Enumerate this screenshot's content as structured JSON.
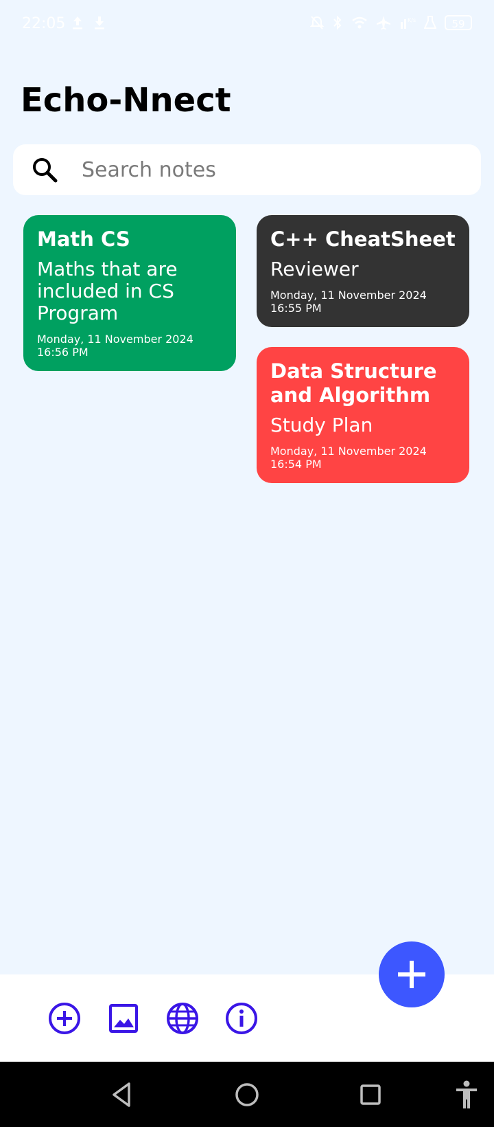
{
  "status_bar": {
    "time": "22:05",
    "left_icons": [
      "upload-icon",
      "download-icon"
    ],
    "right_icons": [
      "bell-off-icon",
      "bluetooth-icon",
      "wifi-icon",
      "airplane-icon",
      "data-speed-icon",
      "flask-icon"
    ],
    "battery": "59"
  },
  "app": {
    "title": "Echo-Nnect"
  },
  "search": {
    "placeholder": "Search notes",
    "value": ""
  },
  "notes": [
    {
      "title": "Math CS",
      "subtitle": "Maths that are included in CS Program",
      "date": "Monday, 11 November 2024 16:56 PM",
      "color": "#00A060"
    },
    {
      "title": "C++ CheatSheet",
      "subtitle": "Reviewer",
      "date": "Monday, 11 November 2024 16:55 PM",
      "color": "#333333"
    },
    {
      "title": "Data Structure and Algorithm",
      "subtitle": "Study Plan",
      "date": "Monday, 11 November 2024 16:54 PM",
      "color": "#FF4444"
    }
  ],
  "bottom_actions": [
    "add-circle-icon",
    "image-icon",
    "globe-icon",
    "info-icon"
  ],
  "fab": {
    "icon": "plus-icon"
  },
  "navigation": [
    "back-icon",
    "home-icon",
    "recents-icon",
    "accessibility-icon"
  ],
  "colors": {
    "background": "#EEF6FF",
    "accent": "#3D57FF",
    "bottom_icon": "#3A16E6"
  }
}
